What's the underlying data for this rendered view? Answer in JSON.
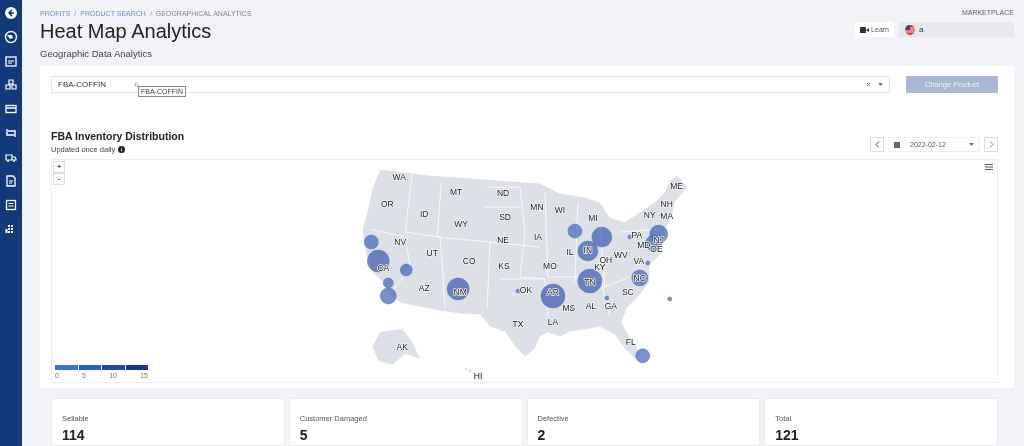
{
  "breadcrumb": {
    "separator": "/",
    "items": [
      {
        "label": "PROFITS",
        "kind": "link"
      },
      {
        "label": "PRODUCT SEARCH",
        "kind": "link"
      },
      {
        "label": "GEOGRAPHICAL ANALYTICS",
        "kind": "current"
      }
    ]
  },
  "title": "Heat Map Analytics",
  "subtitle": "Geographic Data Analytics",
  "marketplace": {
    "label": "MARKETPLACE",
    "value": "a"
  },
  "learn_button": "Learn",
  "product_field": {
    "value": "FBA-COFFIN",
    "tooltip": "FBA-COFFIN"
  },
  "change_button": {
    "label": "Change Product",
    "disabled": true
  },
  "map_card": {
    "title": "FBA Inventory Distribution",
    "note": "Updated once daily",
    "date": "2022-02-12",
    "zoom_in": "+",
    "zoom_out": "-",
    "legend_ticks": [
      "0",
      "5",
      "10",
      "15"
    ],
    "state_labels": [
      "WA",
      "ME",
      "MT",
      "ND",
      "OR",
      "NH",
      "MN",
      "WI",
      "ID",
      "SD",
      "MI",
      "NY",
      "MA",
      "WY",
      "PA",
      "NV",
      "NE",
      "IA",
      "NJ",
      "MD",
      "UT",
      "IL",
      "IN",
      "WV",
      "DE",
      "CO",
      "OH",
      "VA",
      "CA",
      "KS",
      "MO",
      "KY",
      "TN",
      "NC",
      "AZ",
      "NM",
      "OK",
      "AR",
      "SC",
      "MS",
      "AL",
      "GA",
      "TX",
      "LA",
      "FL",
      "AK",
      "HI"
    ]
  },
  "stats": [
    {
      "label": "Sellable",
      "value": "114"
    },
    {
      "label": "Customer Damaged",
      "value": "5"
    },
    {
      "label": "Defective",
      "value": "2"
    },
    {
      "label": "Total",
      "value": "121"
    }
  ]
}
